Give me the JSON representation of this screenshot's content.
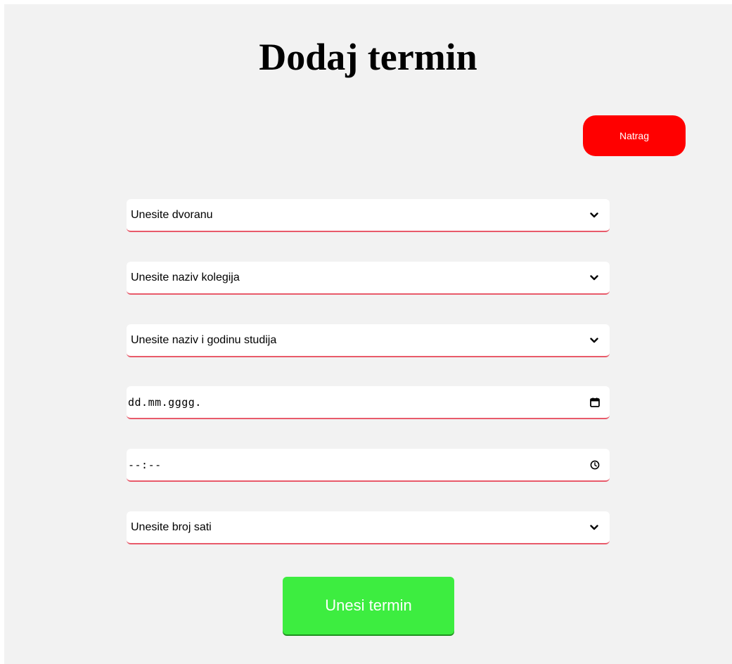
{
  "page": {
    "title": "Dodaj termin"
  },
  "back_button": {
    "label": "Natrag",
    "color": "#ff0000"
  },
  "form": {
    "accent_color": "#e85a6a",
    "fields": [
      {
        "kind": "select",
        "value": "Unesite dvoranu",
        "icon": "chevron-down-icon"
      },
      {
        "kind": "select",
        "value": "Unesite naziv kolegija",
        "icon": "chevron-down-icon"
      },
      {
        "kind": "select",
        "value": "Unesite naziv i godinu studija",
        "icon": "chevron-down-icon"
      },
      {
        "kind": "date",
        "value": "dd.mm.gggg.",
        "icon": "calendar-icon"
      },
      {
        "kind": "time",
        "value": "--:--",
        "icon": "clock-icon"
      },
      {
        "kind": "select",
        "value": "Unesite broj sati",
        "icon": "chevron-down-icon"
      }
    ]
  },
  "submit_button": {
    "label": "Unesi termin",
    "color": "#3ded40"
  }
}
